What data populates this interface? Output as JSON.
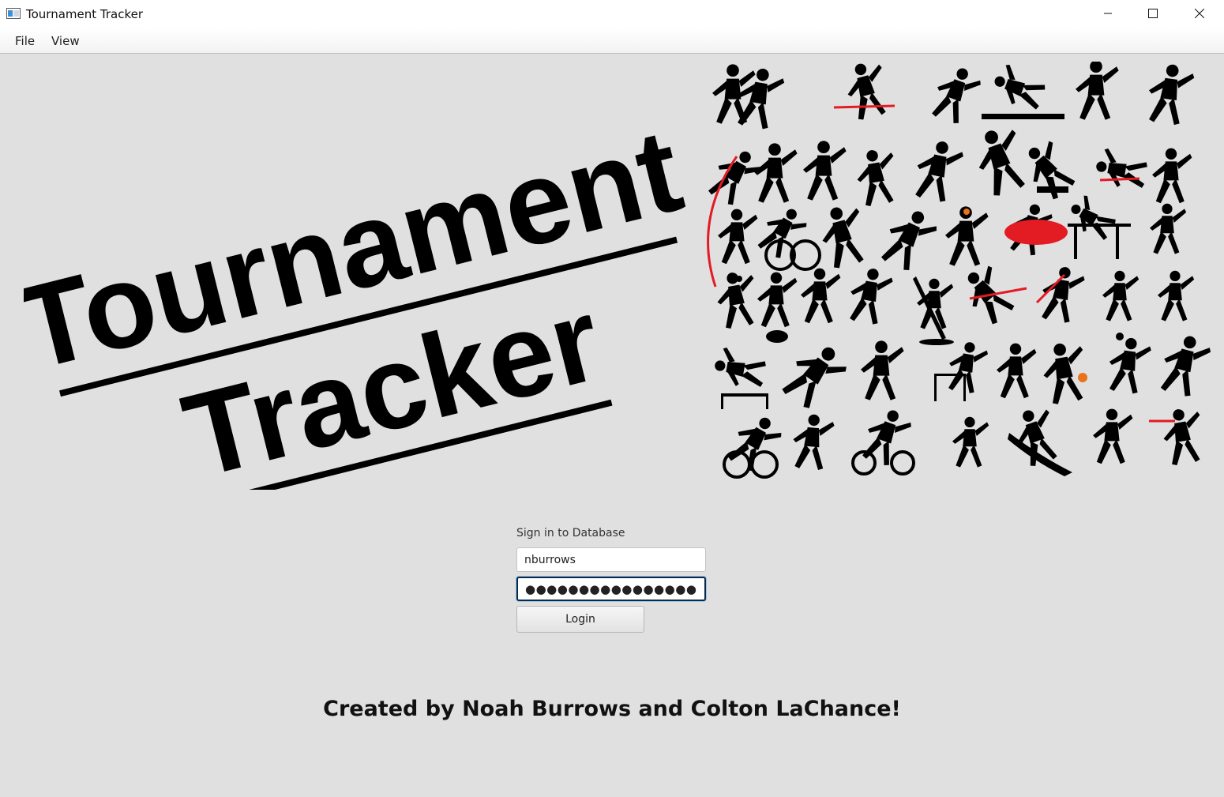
{
  "window": {
    "title": "Tournament Tracker",
    "icon": "java-window-icon",
    "controls": [
      "minimize-icon",
      "maximize-icon",
      "close-icon"
    ]
  },
  "menu": {
    "items": [
      {
        "label": "File"
      },
      {
        "label": "View"
      }
    ]
  },
  "hero": {
    "title_line1": "Tournament",
    "title_line2": "Tracker",
    "artwork": "sports-silhouettes-collage"
  },
  "login": {
    "heading": "Sign in to Database",
    "username_value": "nburrows",
    "password_value": "●●●●●●●●●●●●●●●●●●●●",
    "button_label": "Login"
  },
  "footer": {
    "credits": "Created by Noah Burrows and Colton LaChance!"
  },
  "colors": {
    "background": "#e0e0e0",
    "accent_red": "#e31b23",
    "accent_orange": "#e8731a",
    "focus_border": "#0b2a47"
  }
}
